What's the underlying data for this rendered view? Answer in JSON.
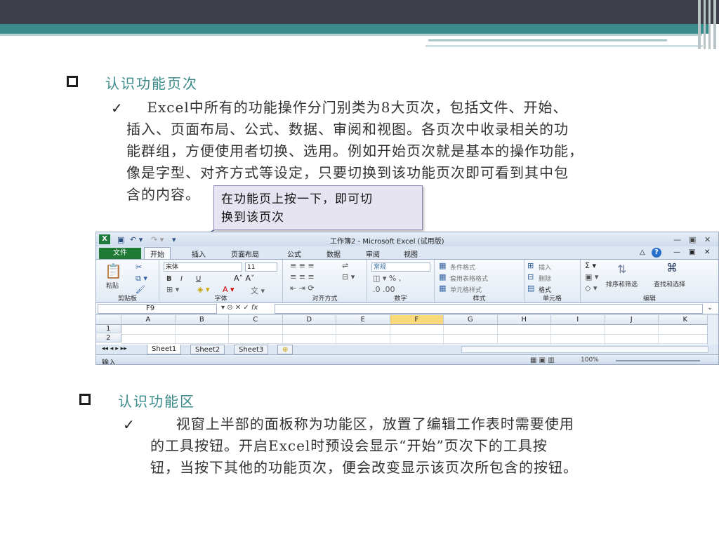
{
  "section1": {
    "heading": "认识功能页次",
    "para_lines": [
      "    Excel中所有的功能操作分门别类为8大页次，包括文件、开始、",
      "插入、页面布局、公式、数据、审阅和视图。各页次中收录相关的功",
      "能群组，方便使用者切换、选用。例如开始页次就是基本的操作功能，",
      "像是字型、对齐方式等设定，只要切换到该功能页次即可看到其中包",
      "含的内容。"
    ]
  },
  "callout": {
    "lines": [
      "在功能页上按一下，即可切",
      "换到该页次"
    ]
  },
  "excel": {
    "window_title": "工作簿2 - Microsoft Excel (试用版)",
    "logo": "X",
    "file_tab": "文件",
    "tabs": [
      "开始",
      "插入",
      "页面布局",
      "公式",
      "数据",
      "审阅",
      "视图"
    ],
    "active_tab": "开始",
    "ribbon": {
      "clipboard": {
        "label": "剪贴板",
        "paste": "粘贴"
      },
      "font": {
        "label": "字体",
        "font_name": "宋体",
        "font_size": "11",
        "bold": "B",
        "italic": "I",
        "underline": "U"
      },
      "alignment": {
        "label": "对齐方式"
      },
      "number": {
        "label": "数字",
        "format": "常规"
      },
      "styles": {
        "label": "样式",
        "items": [
          "条件格式",
          "套用表格格式",
          "单元格样式"
        ]
      },
      "cells": {
        "label": "单元格",
        "items": [
          "插入",
          "删除",
          "格式"
        ]
      },
      "editing": {
        "label": "编辑",
        "sort": "排序和筛选",
        "find": "查找和选择"
      }
    },
    "name_box": "F9",
    "fx": "fx",
    "columns": [
      "A",
      "B",
      "C",
      "D",
      "E",
      "F",
      "G",
      "H",
      "I",
      "J",
      "K"
    ],
    "selected_column": "F",
    "rows": [
      "1",
      "2"
    ],
    "sheets": [
      "Sheet1",
      "Sheet2",
      "Sheet3"
    ],
    "status": "输入",
    "zoom": "100%"
  },
  "section2": {
    "heading": "认识功能区",
    "para_lines": [
      "     视窗上半部的面板称为功能区，放置了编辑工作表时需要使用",
      "的工具按钮。开启Excel时预设会显示“开始”页次下的工具按",
      "钮，当按下其他的功能页次，便会改变显示该页次所包含的按钮。"
    ]
  },
  "colors": {
    "topbar": "#3d3f4b",
    "teal": "#3a8a8a",
    "callout_bg": "#e6e4f1",
    "excel_green": "#1e7a35"
  }
}
